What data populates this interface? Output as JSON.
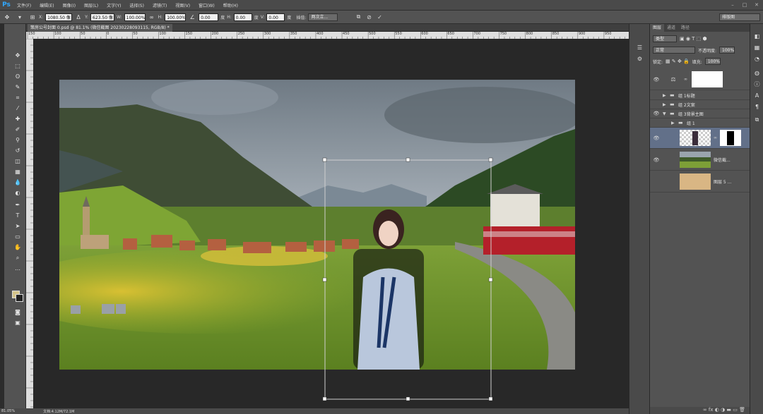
{
  "menu": {
    "logo": "Ps",
    "items": [
      "文件(F)",
      "编辑(E)",
      "图像(I)",
      "图层(L)",
      "文字(Y)",
      "选择(S)",
      "滤镜(T)",
      "视图(V)",
      "窗口(W)",
      "帮助(H)"
    ]
  },
  "options": {
    "x_label": "X:",
    "x_value": "1080.50 像",
    "y_label": "Y:",
    "y_value": "623.50 像",
    "w_label": "W:",
    "w_value": "100.00%",
    "h_label": "H:",
    "h_value": "100.00%",
    "angle_value": "0.00",
    "angle_unit": "度",
    "hskew_label": "H:",
    "hskew_value": "0.00",
    "hskew_unit": "度",
    "vskew_label": "V:",
    "vskew_value": "0.00",
    "vskew_unit": "度",
    "interp_label": "插值:",
    "interp_value": "两次立...",
    "workspace": "排版图"
  },
  "document": {
    "tab_title": "策房公号封面 0.psd @ 81.1% (微信截图 20230228093115, RGB/8) *"
  },
  "ruler_top": [
    "150",
    "100",
    "50",
    "0",
    "50",
    "100",
    "150",
    "200",
    "250",
    "300",
    "350",
    "400",
    "450",
    "500",
    "550",
    "600",
    "650",
    "700",
    "750",
    "800",
    "850",
    "900",
    "950"
  ],
  "status": {
    "zoom": "81.05%",
    "doc_info": "文档:4.12M/72.1M"
  },
  "panel": {
    "tabs": [
      "图层",
      "通道",
      "路径"
    ],
    "filter_kind": "类型",
    "blend_mode": "正常",
    "opacity_label": "不透明度:",
    "opacity_value": "100%",
    "lock_label": "锁定:",
    "fill_label": "填充:",
    "fill_value": "100%",
    "layers": [
      {
        "name": "",
        "type": "adjustment"
      },
      {
        "name": "组 1标题",
        "type": "group"
      },
      {
        "name": "组 2文案",
        "type": "group"
      },
      {
        "name": "组 3背景主图",
        "type": "group-open"
      },
      {
        "name": "组 1",
        "type": "group"
      },
      {
        "name": "",
        "type": "person-mask"
      },
      {
        "name": "微信截...",
        "type": "landscape"
      },
      {
        "name": "图层 5 ...",
        "type": "fill"
      }
    ]
  },
  "colors": {
    "foreground": "#d4c48a",
    "background": "#222222",
    "accent": "#31a8ff"
  }
}
